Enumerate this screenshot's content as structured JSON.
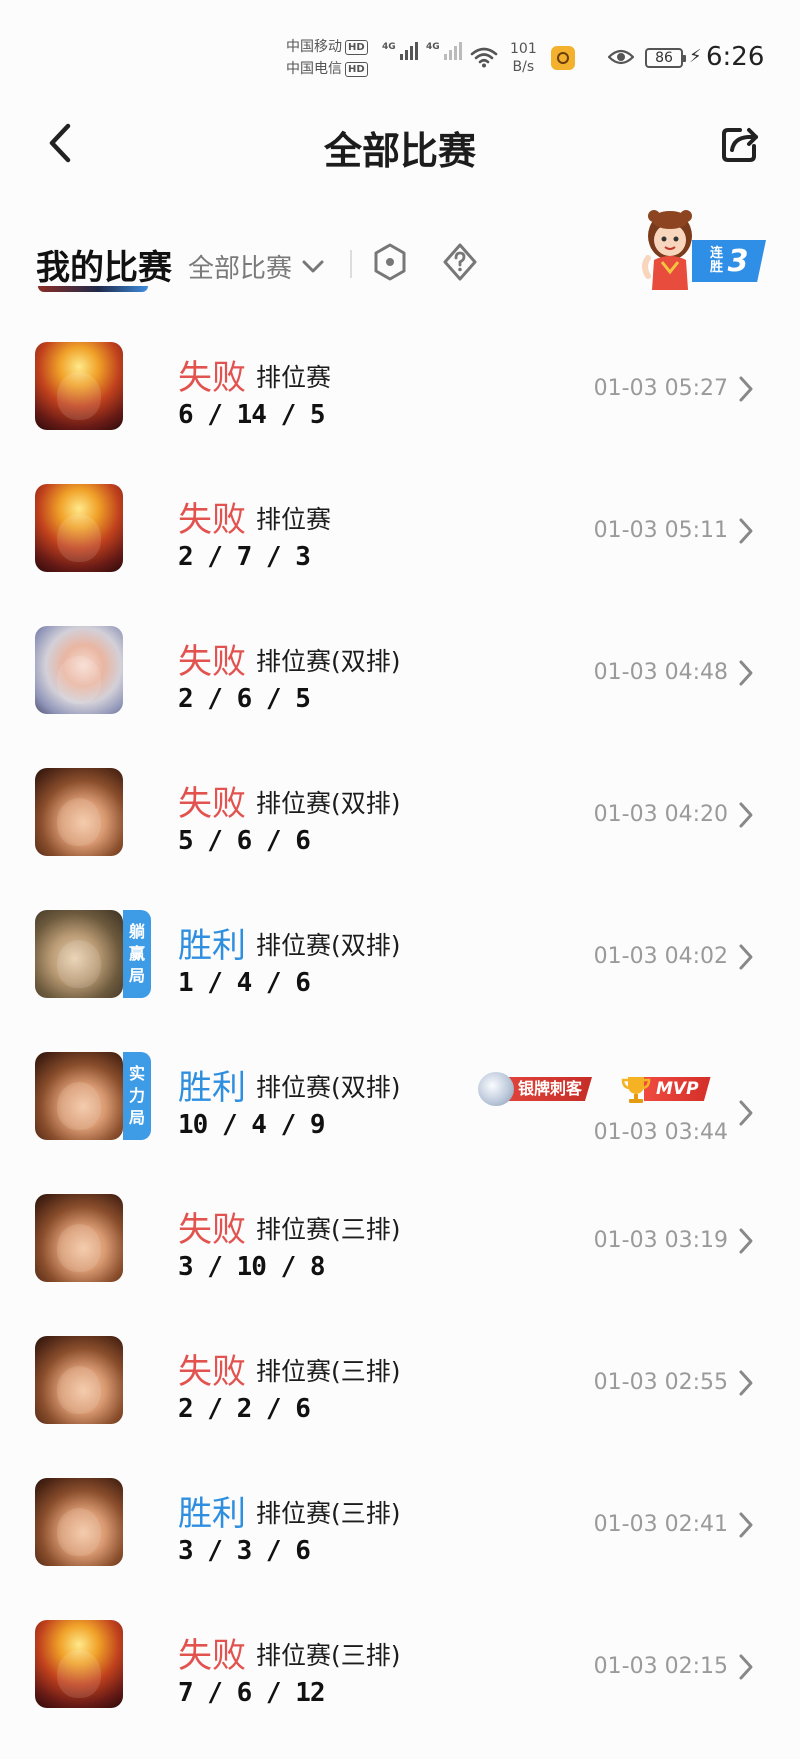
{
  "status_bar": {
    "carrier1": "中国移动",
    "carrier2": "中国电信",
    "hd_label": "HD",
    "network_type": "4G",
    "speed_value": "101",
    "speed_unit": "B/s",
    "battery": "86",
    "time": "6:26"
  },
  "header": {
    "title": "全部比赛"
  },
  "my_matches": {
    "title": "我的比赛",
    "filter_label": "全部比赛",
    "streak_label": "连胜",
    "streak_count": "3"
  },
  "matches": [
    {
      "result": "失败",
      "result_type": "lose",
      "mode": "排位赛",
      "kda": "6 / 14 / 5",
      "time": "01-03 05:27",
      "hero_icon": "fire-monkey-hero-avatar"
    },
    {
      "result": "失败",
      "result_type": "lose",
      "mode": "排位赛",
      "kda": "2 / 7 / 3",
      "time": "01-03 05:11",
      "hero_icon": "fire-monkey-hero-avatar"
    },
    {
      "result": "失败",
      "result_type": "lose",
      "mode": "排位赛(双排)",
      "kda": "2 / 6 / 5",
      "time": "01-03 04:48",
      "hero_icon": "white-hair-hero-avatar"
    },
    {
      "result": "失败",
      "result_type": "lose",
      "mode": "排位赛(双排)",
      "kda": "5 / 6 / 6",
      "time": "01-03 04:20",
      "hero_icon": "brown-hair-hero-avatar"
    },
    {
      "result": "胜利",
      "result_type": "win",
      "mode": "排位赛(双排)",
      "kda": "1 / 4 / 6",
      "time": "01-03 04:02",
      "hero_icon": "glasses-hero-avatar",
      "tag": [
        "躺",
        "赢",
        "局"
      ]
    },
    {
      "result": "胜利",
      "result_type": "win",
      "mode": "排位赛(双排)",
      "kda": "10 / 4 / 9",
      "time": "01-03 03:44",
      "hero_icon": "brown-hair-hero-avatar",
      "tag": [
        "实",
        "力",
        "局"
      ],
      "honors": {
        "silver": "银牌刺客",
        "mvp": "MVP"
      }
    },
    {
      "result": "失败",
      "result_type": "lose",
      "mode": "排位赛(三排)",
      "kda": "3 / 10 / 8",
      "time": "01-03 03:19",
      "hero_icon": "brown-hair-hero-avatar"
    },
    {
      "result": "失败",
      "result_type": "lose",
      "mode": "排位赛(三排)",
      "kda": "2 / 2 / 6",
      "time": "01-03 02:55",
      "hero_icon": "brown-hair-hero-avatar"
    },
    {
      "result": "胜利",
      "result_type": "win",
      "mode": "排位赛(三排)",
      "kda": "3 / 3 / 6",
      "time": "01-03 02:41",
      "hero_icon": "brown-hair-hero-avatar"
    },
    {
      "result": "失败",
      "result_type": "lose",
      "mode": "排位赛(三排)",
      "kda": "7 / 6 / 12",
      "time": "01-03 02:15",
      "hero_icon": "fire-monkey-hero-avatar"
    }
  ],
  "colors": {
    "lose": "#e2534f",
    "win": "#2e8fe0",
    "tag_badge": "#3e9be6",
    "background": "#fdfcfd"
  }
}
